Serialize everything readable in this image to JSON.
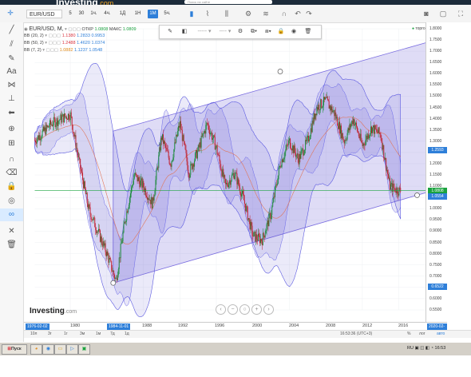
{
  "header": {
    "brand": "Investing",
    "brand_suffix": ".com",
    "search_placeholder": "Поиск на сайте"
  },
  "toolbar": {
    "symbol": "EUR/USD",
    "periods": [
      "5",
      "30",
      "1ч.",
      "4ч.",
      "1Д",
      "1Н",
      "1М",
      "5ч."
    ],
    "active_period": "1М"
  },
  "legend": {
    "series_title": "EUR/USD, M,",
    "open_label": "ОТКР",
    "open_value": "1.0808",
    "high_label": "МАКС",
    "high_value": "1.0809",
    "bb1_name": "BB (20, 2)",
    "bb1_values": [
      "1.1380",
      "1.2833",
      "0.9953"
    ],
    "bb2_name": "BB (50, 2)",
    "bb2_values": [
      "1.2488",
      "1.4620",
      "1.0374"
    ],
    "bb3_name": "BB (7, 2)",
    "bb3_values": [
      "1.0882",
      "1.1237",
      "1.0548"
    ]
  },
  "trading_sessions": "торговая сессия",
  "price_axis": {
    "ticks": [
      "1.8000",
      "1.7500",
      "1.7000",
      "1.6500",
      "1.6000",
      "1.5500",
      "1.5000",
      "1.4500",
      "1.4000",
      "1.3500",
      "1.3000",
      "1.2500",
      "1.2000",
      "1.1500",
      "1.1000",
      "1.0500",
      "1.0000",
      "0.9500",
      "0.9000",
      "0.8500",
      "0.8000",
      "0.7500",
      "0.7000",
      "0.6500",
      "0.6000",
      "0.5500"
    ],
    "tag_upper": "1.2593",
    "tag_current": "1.0808",
    "tag_lower": "1.0554",
    "tag_bottom": "0.6522",
    "colors": {
      "upper": "#2e7fd9",
      "current": "#1ba33f",
      "lower": "#2e7fd9",
      "bottom": "#2e7fd9"
    }
  },
  "time_axis": {
    "start_tag": "1976-02-02",
    "ticks": [
      "1980",
      "1984-11-01",
      "1988",
      "1992",
      "1996",
      "2000",
      "2004",
      "2008",
      "2012",
      "2016"
    ],
    "end_tag": "2020-02-02"
  },
  "range_buttons": [
    "10л",
    "3г",
    "1г",
    "3м",
    "1м",
    "7д",
    "1д"
  ],
  "status": {
    "clock": "16:53:36 (UTC+3)",
    "percent": "%",
    "log": "лог",
    "auto": "авто"
  },
  "watermark": {
    "text": "Investing",
    "suffix": ".com"
  },
  "taskbar": {
    "start": "Пуск",
    "lang": "RU",
    "time": "16:53"
  },
  "chart_data": {
    "type": "line",
    "title": "EUR/USD, M",
    "x_range": [
      "1976-02-02",
      "2020-02-02"
    ],
    "ylim": [
      0.55,
      1.8
    ],
    "series": [
      {
        "name": "EUR/USD",
        "x": [
          1976,
          1978,
          1980,
          1981,
          1982,
          1984,
          1985,
          1986,
          1987,
          1988,
          1989,
          1990,
          1991,
          1992,
          1993,
          1994,
          1995,
          1996,
          1997,
          1998,
          1999,
          2000,
          2001,
          2002,
          2003,
          2004,
          2005,
          2006,
          2007,
          2008,
          2009,
          2010,
          2011,
          2012,
          2013,
          2014,
          2015,
          2016
        ],
        "y": [
          1.3,
          1.38,
          1.42,
          1.2,
          1.0,
          0.8,
          0.68,
          0.95,
          1.15,
          1.1,
          1.02,
          1.32,
          1.2,
          1.38,
          1.16,
          1.26,
          1.38,
          1.27,
          1.1,
          1.16,
          1.04,
          0.88,
          0.86,
          0.98,
          1.2,
          1.3,
          1.22,
          1.3,
          1.45,
          1.48,
          1.42,
          1.3,
          1.4,
          1.28,
          1.36,
          1.33,
          1.1,
          1.08
        ]
      }
    ],
    "channel": {
      "upper": [
        [
          1986,
          1.36
        ],
        [
          2020,
          1.75
        ]
      ],
      "lower": [
        [
          1984.7,
          0.67
        ],
        [
          2018,
          1.06
        ]
      ],
      "anchors": [
        [
          1984.7,
          0.67
        ],
        [
          2003,
          1.61
        ],
        [
          2018,
          1.06
        ]
      ]
    }
  }
}
